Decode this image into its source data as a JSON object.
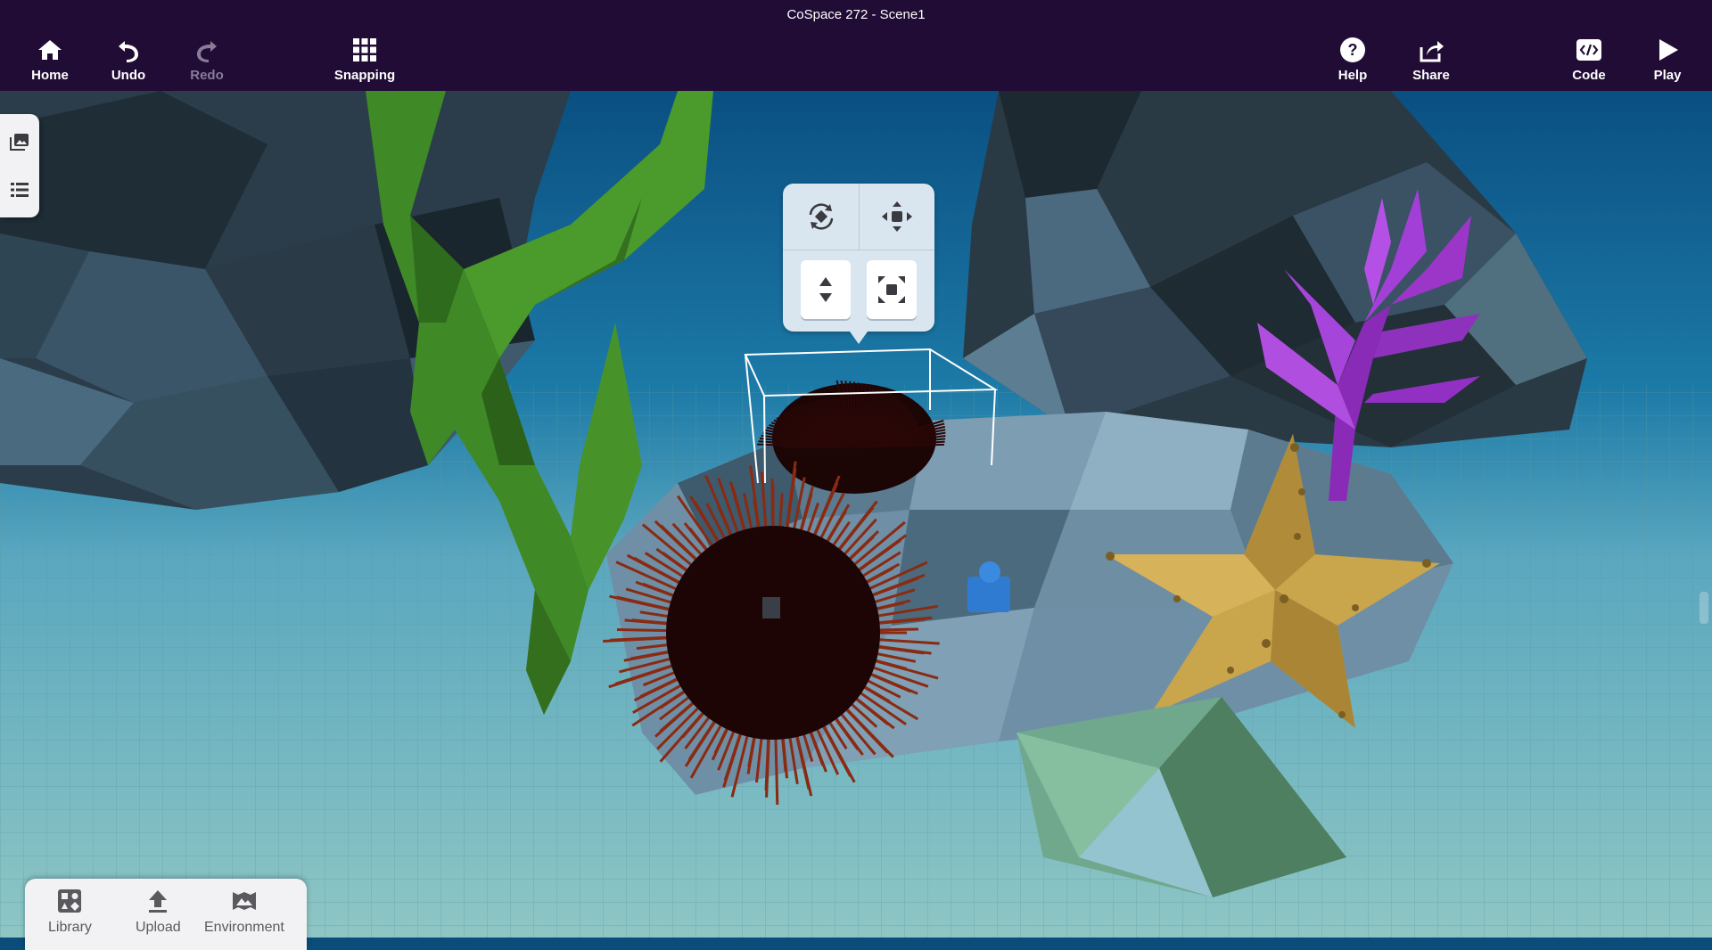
{
  "window": {
    "title": "CoSpace 272 - Scene1"
  },
  "toolbar": {
    "home": "Home",
    "undo": "Undo",
    "redo": "Redo",
    "snapping": "Snapping",
    "help": "Help",
    "share": "Share",
    "code": "Code",
    "play": "Play"
  },
  "side_panel": {
    "items": [
      "gallery-icon",
      "list-icon"
    ]
  },
  "gizmo": {
    "tools": [
      "rotate-icon",
      "move-icon",
      "lift-icon",
      "scale-icon"
    ]
  },
  "bottom_panel": {
    "library": "Library",
    "upload": "Upload",
    "environment": "Environment"
  },
  "colors": {
    "topbar": "#210c35",
    "water": "#0b5c8e",
    "floor": "#7fb7b4",
    "rock": "#3e5466",
    "kelp": "#3f8a26",
    "coral": "#9b36c9",
    "starfish": "#c9a54c",
    "urchin": "#1e0505"
  }
}
